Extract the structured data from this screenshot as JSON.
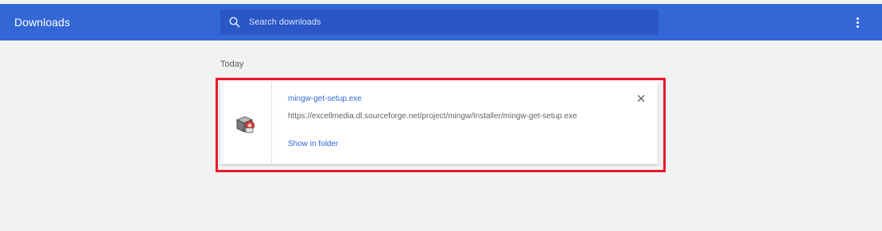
{
  "header": {
    "title": "Downloads",
    "search_placeholder": "Search downloads",
    "search_value": "",
    "accent_color": "#3367d6",
    "icons": {
      "search": "search-icon",
      "menu": "more-vert-icon"
    }
  },
  "sections": [
    {
      "label": "Today",
      "items": [
        {
          "file_name": "mingw-get-setup.exe",
          "url": "https://excellmedia.dl.sourceforge.net/project/mingw/Installer/mingw-get-setup.exe",
          "action_label": "Show in folder",
          "icon": "installer-file-icon",
          "highlight_color": "#e8182a"
        }
      ]
    }
  ]
}
